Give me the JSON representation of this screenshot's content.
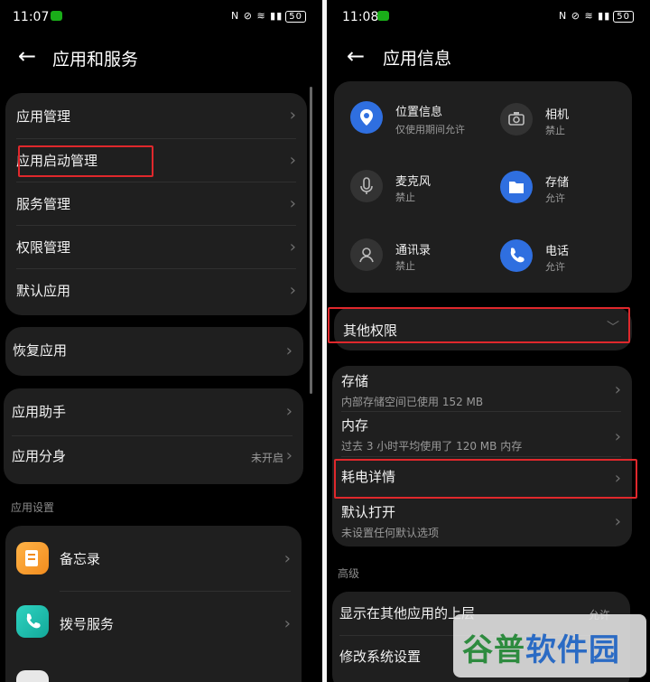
{
  "left": {
    "status": {
      "time": "11:07",
      "icons": "N ⊘ ≋ ▮▮",
      "battery": "50"
    },
    "title": "应用和服务",
    "group1": [
      "应用管理",
      "应用启动管理",
      "服务管理",
      "权限管理",
      "默认应用"
    ],
    "group2": [
      "恢复应用"
    ],
    "group3": {
      "assistant": "应用助手",
      "clone": "应用分身",
      "clone_value": "未开启"
    },
    "section": "应用设置",
    "apps": [
      "备忘录",
      "拨号服务"
    ]
  },
  "right": {
    "status": {
      "time": "11:08",
      "icons": "N ⊘ ≋ ▮▮",
      "battery": "50"
    },
    "title": "应用信息",
    "permissions": [
      {
        "name": "位置信息",
        "status": "仅使用期间允许"
      },
      {
        "name": "相机",
        "status": "禁止"
      },
      {
        "name": "麦克风",
        "status": "禁止"
      },
      {
        "name": "存储",
        "status": "允许"
      },
      {
        "name": "通讯录",
        "status": "禁止"
      },
      {
        "name": "电话",
        "status": "允许"
      }
    ],
    "other_permissions": "其他权限",
    "details": [
      {
        "label": "存储",
        "sub": "内部存储空间已使用 152 MB"
      },
      {
        "label": "内存",
        "sub": "过去 3 小时平均使用了 120 MB 内存"
      },
      {
        "label": "耗电详情",
        "sub": ""
      },
      {
        "label": "默认打开",
        "sub": "未设置任何默认选项"
      }
    ],
    "section": "高级",
    "advanced": [
      {
        "label": "显示在其他应用的上层",
        "value": "允许"
      },
      {
        "label": "修改系统设置",
        "value": ""
      }
    ]
  },
  "watermark": {
    "part1": "谷普",
    "part2": "软件园"
  },
  "colors": {
    "background": "#000000",
    "card": "#1f1f1f",
    "highlight": "#e0282c",
    "accent_blue": "#2f6fe0"
  }
}
